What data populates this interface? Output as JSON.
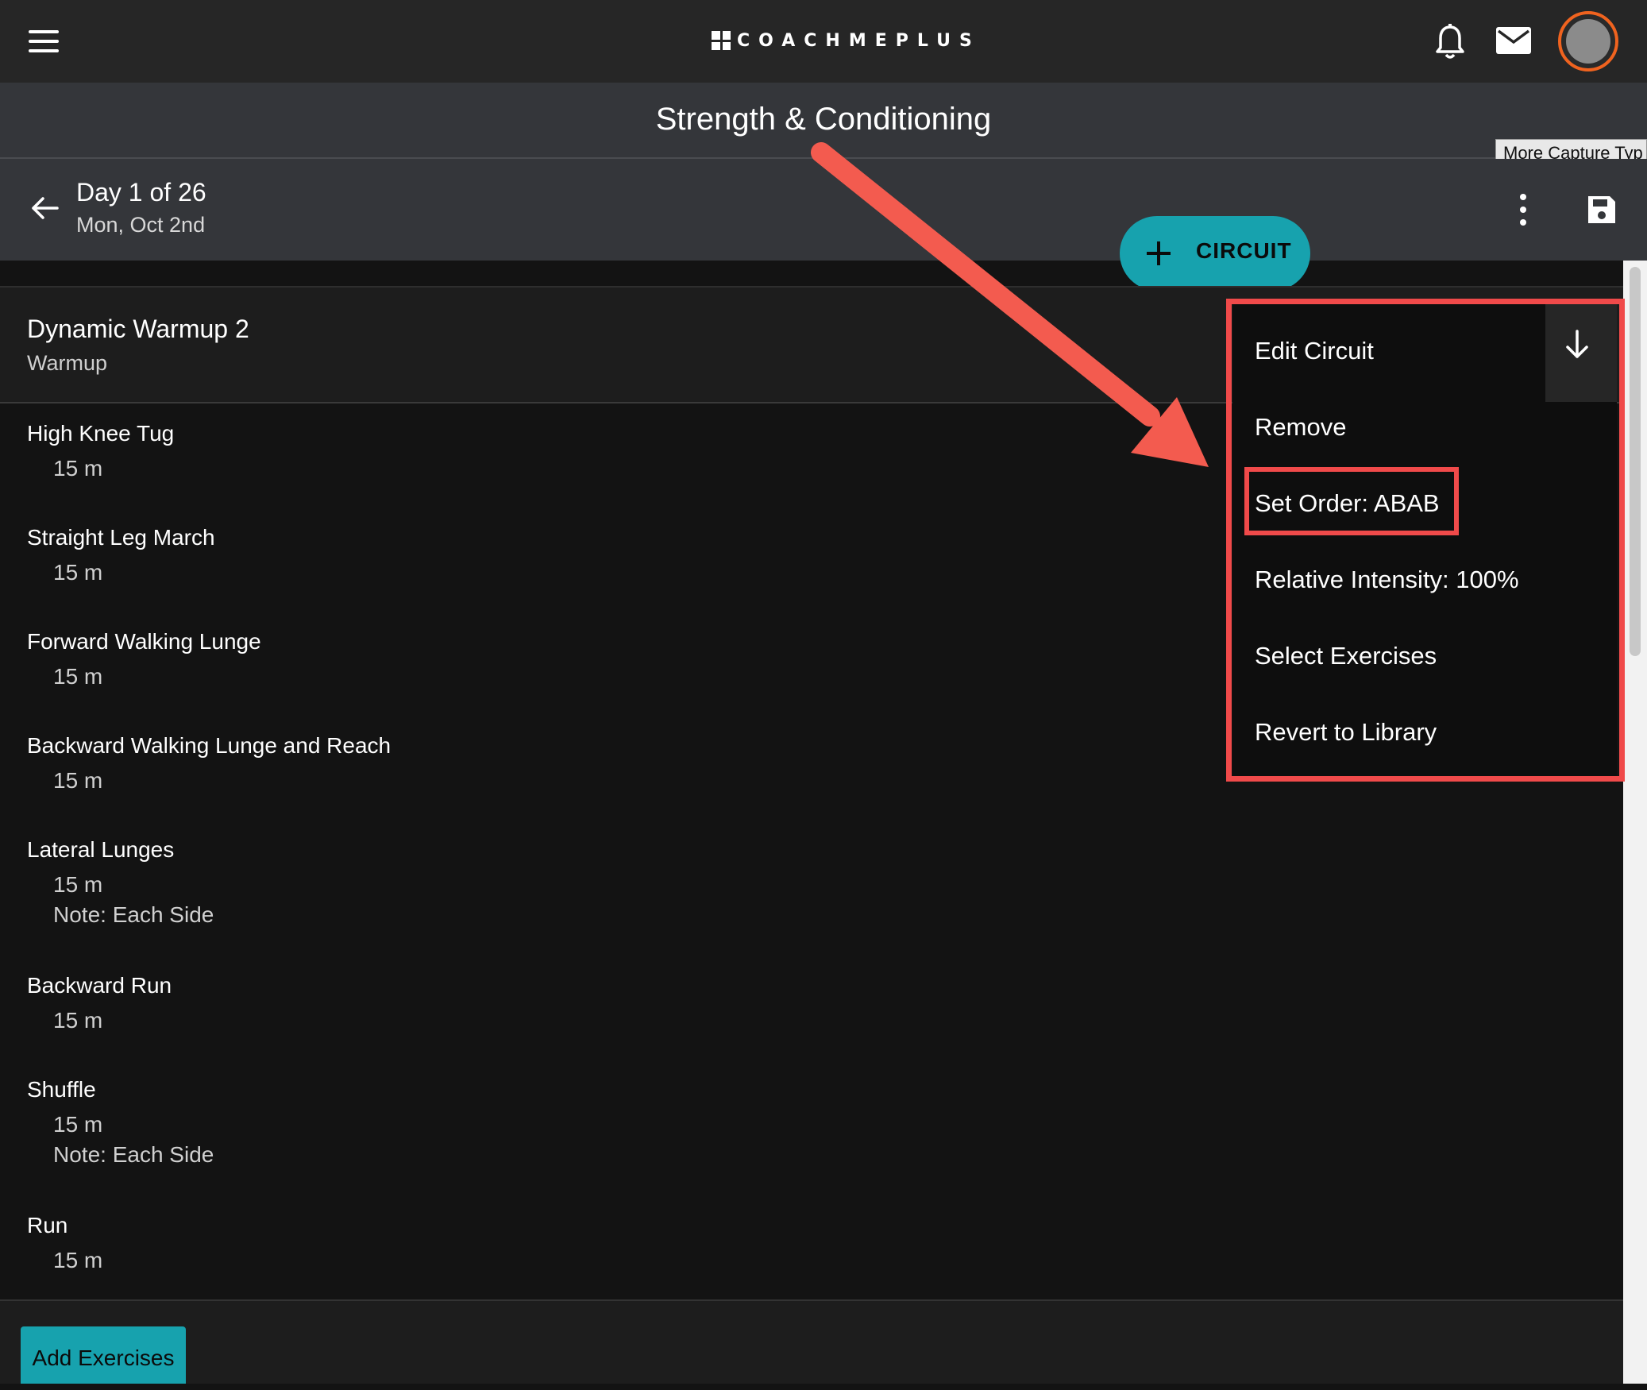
{
  "topbar": {
    "logo_text": "COACHMEPLUS",
    "icons": [
      "menu-icon",
      "bell-icon",
      "mail-icon",
      "avatar"
    ]
  },
  "page": {
    "title": "Strength & Conditioning"
  },
  "day": {
    "title": "Day 1 of 26",
    "date": "Mon, Oct 2nd"
  },
  "tooltip": "More Capture Typ",
  "circuit_button": {
    "label": "CIRCUIT"
  },
  "section": {
    "title": "Dynamic Warmup 2",
    "subtitle": "Warmup"
  },
  "exercises": [
    {
      "name": "High Knee Tug",
      "detail": "15 m"
    },
    {
      "name": "Straight Leg March",
      "detail": "15 m"
    },
    {
      "name": "Forward Walking Lunge",
      "detail": "15 m"
    },
    {
      "name": "Backward Walking Lunge and Reach",
      "detail": "15 m"
    },
    {
      "name": "Lateral Lunges",
      "detail": "15 m",
      "note": "Note: Each Side"
    },
    {
      "name": "Backward Run",
      "detail": "15 m"
    },
    {
      "name": "Shuffle",
      "detail": "15 m",
      "note": "Note: Each Side"
    },
    {
      "name": "Run",
      "detail": "15 m"
    }
  ],
  "dropdown": {
    "items": [
      "Edit Circuit",
      "Remove",
      "Set Order: ABAB",
      "Relative Intensity: 100%",
      "Select Exercises",
      "Revert to Library"
    ]
  },
  "footer": {
    "add_label": "Add Exercises"
  },
  "colors": {
    "accent": "#17a2ae",
    "highlight": "#f04a4a",
    "avatar_ring": "#f0631f"
  }
}
